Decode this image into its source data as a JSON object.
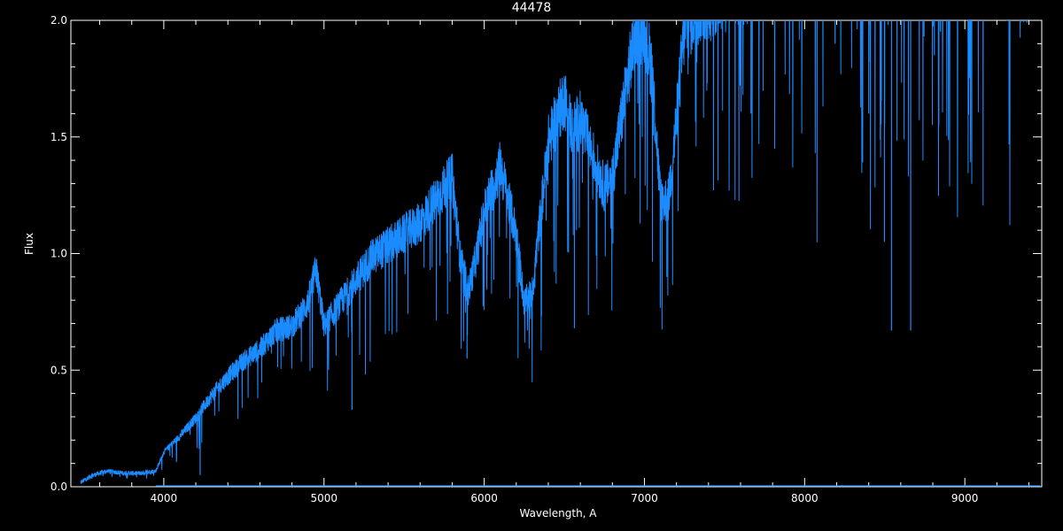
{
  "chart_data": {
    "type": "line",
    "title": "44478",
    "xlabel": "Wavelength, A",
    "ylabel": "Flux",
    "xlim": [
      3420,
      9480
    ],
    "ylim": [
      0,
      2.0
    ],
    "x_ticks": [
      4000,
      5000,
      6000,
      7000,
      8000,
      9000
    ],
    "y_ticks": [
      0.0,
      0.5,
      1.0,
      1.5,
      2.0
    ],
    "y_tick_labels": [
      "0.0",
      "0.5",
      "1.0",
      "1.5",
      "2.0"
    ],
    "grid": false,
    "series_color": "#1a8cff",
    "series": [
      {
        "x": [
          3480,
          3550,
          3650,
          3750,
          3850,
          3950,
          4000,
          4100,
          4200,
          4300,
          4400,
          4500,
          4600,
          4700,
          4800,
          4900,
          4950,
          5000,
          5100,
          5200,
          5300,
          5400,
          5500,
          5600,
          5700,
          5800,
          5850,
          5900,
          5950,
          6000,
          6100,
          6200,
          6250,
          6300,
          6400,
          6500,
          6550,
          6600,
          6650,
          6700,
          6750,
          6800,
          6900,
          6950,
          7000,
          7050,
          7100,
          7150,
          7200,
          7250,
          7300,
          7350,
          7500,
          7700,
          8000,
          8300,
          8500,
          8700,
          9000,
          9300,
          9450
        ],
        "values": [
          0.02,
          0.05,
          0.07,
          0.06,
          0.06,
          0.07,
          0.15,
          0.22,
          0.3,
          0.4,
          0.48,
          0.55,
          0.6,
          0.68,
          0.7,
          0.8,
          0.95,
          0.7,
          0.8,
          0.9,
          1.0,
          1.05,
          1.1,
          1.15,
          1.25,
          1.35,
          1.0,
          0.85,
          1.0,
          1.2,
          1.4,
          1.1,
          0.8,
          0.85,
          1.5,
          1.7,
          1.55,
          1.6,
          1.5,
          1.4,
          1.3,
          1.35,
          1.8,
          2.0,
          2.0,
          1.8,
          1.25,
          1.25,
          1.6,
          2.0,
          2.05,
          2.1,
          2.15,
          2.2,
          2.25,
          2.3,
          2.3,
          2.3,
          2.25,
          2.2,
          2.2
        ]
      }
    ],
    "absorption_lines": [
      {
        "x": 4227,
        "min": 0.05
      },
      {
        "x": 5175,
        "min": 0.33
      },
      {
        "x": 5893,
        "min": 0.55
      },
      {
        "x": 6563,
        "min": 0.68
      },
      {
        "x": 7140,
        "min": 0.9
      },
      {
        "x": 7665,
        "min": 1.6
      },
      {
        "x": 8542,
        "min": 0.67
      },
      {
        "x": 8662,
        "min": 0.67
      },
      {
        "x": 8498,
        "min": 1.05
      },
      {
        "x": 8400,
        "min": 1.6
      },
      {
        "x": 8810,
        "min": 1.85
      },
      {
        "x": 8190,
        "min": 1.9
      }
    ],
    "baseline_value": 0.0
  }
}
